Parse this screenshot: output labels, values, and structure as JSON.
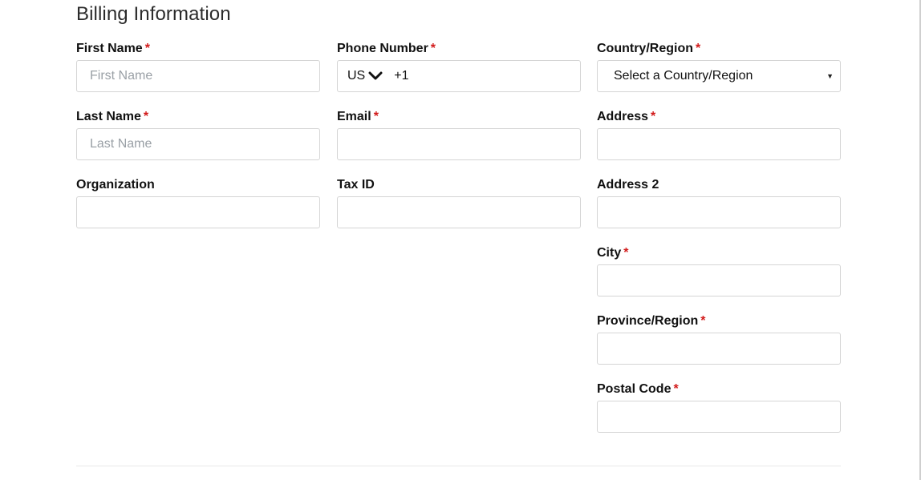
{
  "page": {
    "title": "Billing Information",
    "required_mark": "*"
  },
  "fields": {
    "first_name": {
      "label": "First Name",
      "placeholder": "First Name",
      "value": ""
    },
    "last_name": {
      "label": "Last Name",
      "placeholder": "Last Name",
      "value": ""
    },
    "organization": {
      "label": "Organization",
      "value": ""
    },
    "phone": {
      "label": "Phone Number",
      "country_code": "US",
      "dial_code": "+1",
      "value": ""
    },
    "email": {
      "label": "Email",
      "value": ""
    },
    "tax_id": {
      "label": "Tax ID",
      "value": ""
    },
    "country": {
      "label": "Country/Region",
      "selected": "Select a Country/Region"
    },
    "address": {
      "label": "Address",
      "value": ""
    },
    "address2": {
      "label": "Address 2",
      "value": ""
    },
    "city": {
      "label": "City",
      "value": ""
    },
    "province": {
      "label": "Province/Region",
      "value": ""
    },
    "postal_code": {
      "label": "Postal Code",
      "value": ""
    }
  },
  "colors": {
    "required": "#d21b1b",
    "border": "#d5d5d5",
    "placeholder": "#9aa0a6"
  },
  "icons": {
    "phone_country_chevron": "chevron-down-icon",
    "country_select_caret": "caret-down-icon"
  }
}
